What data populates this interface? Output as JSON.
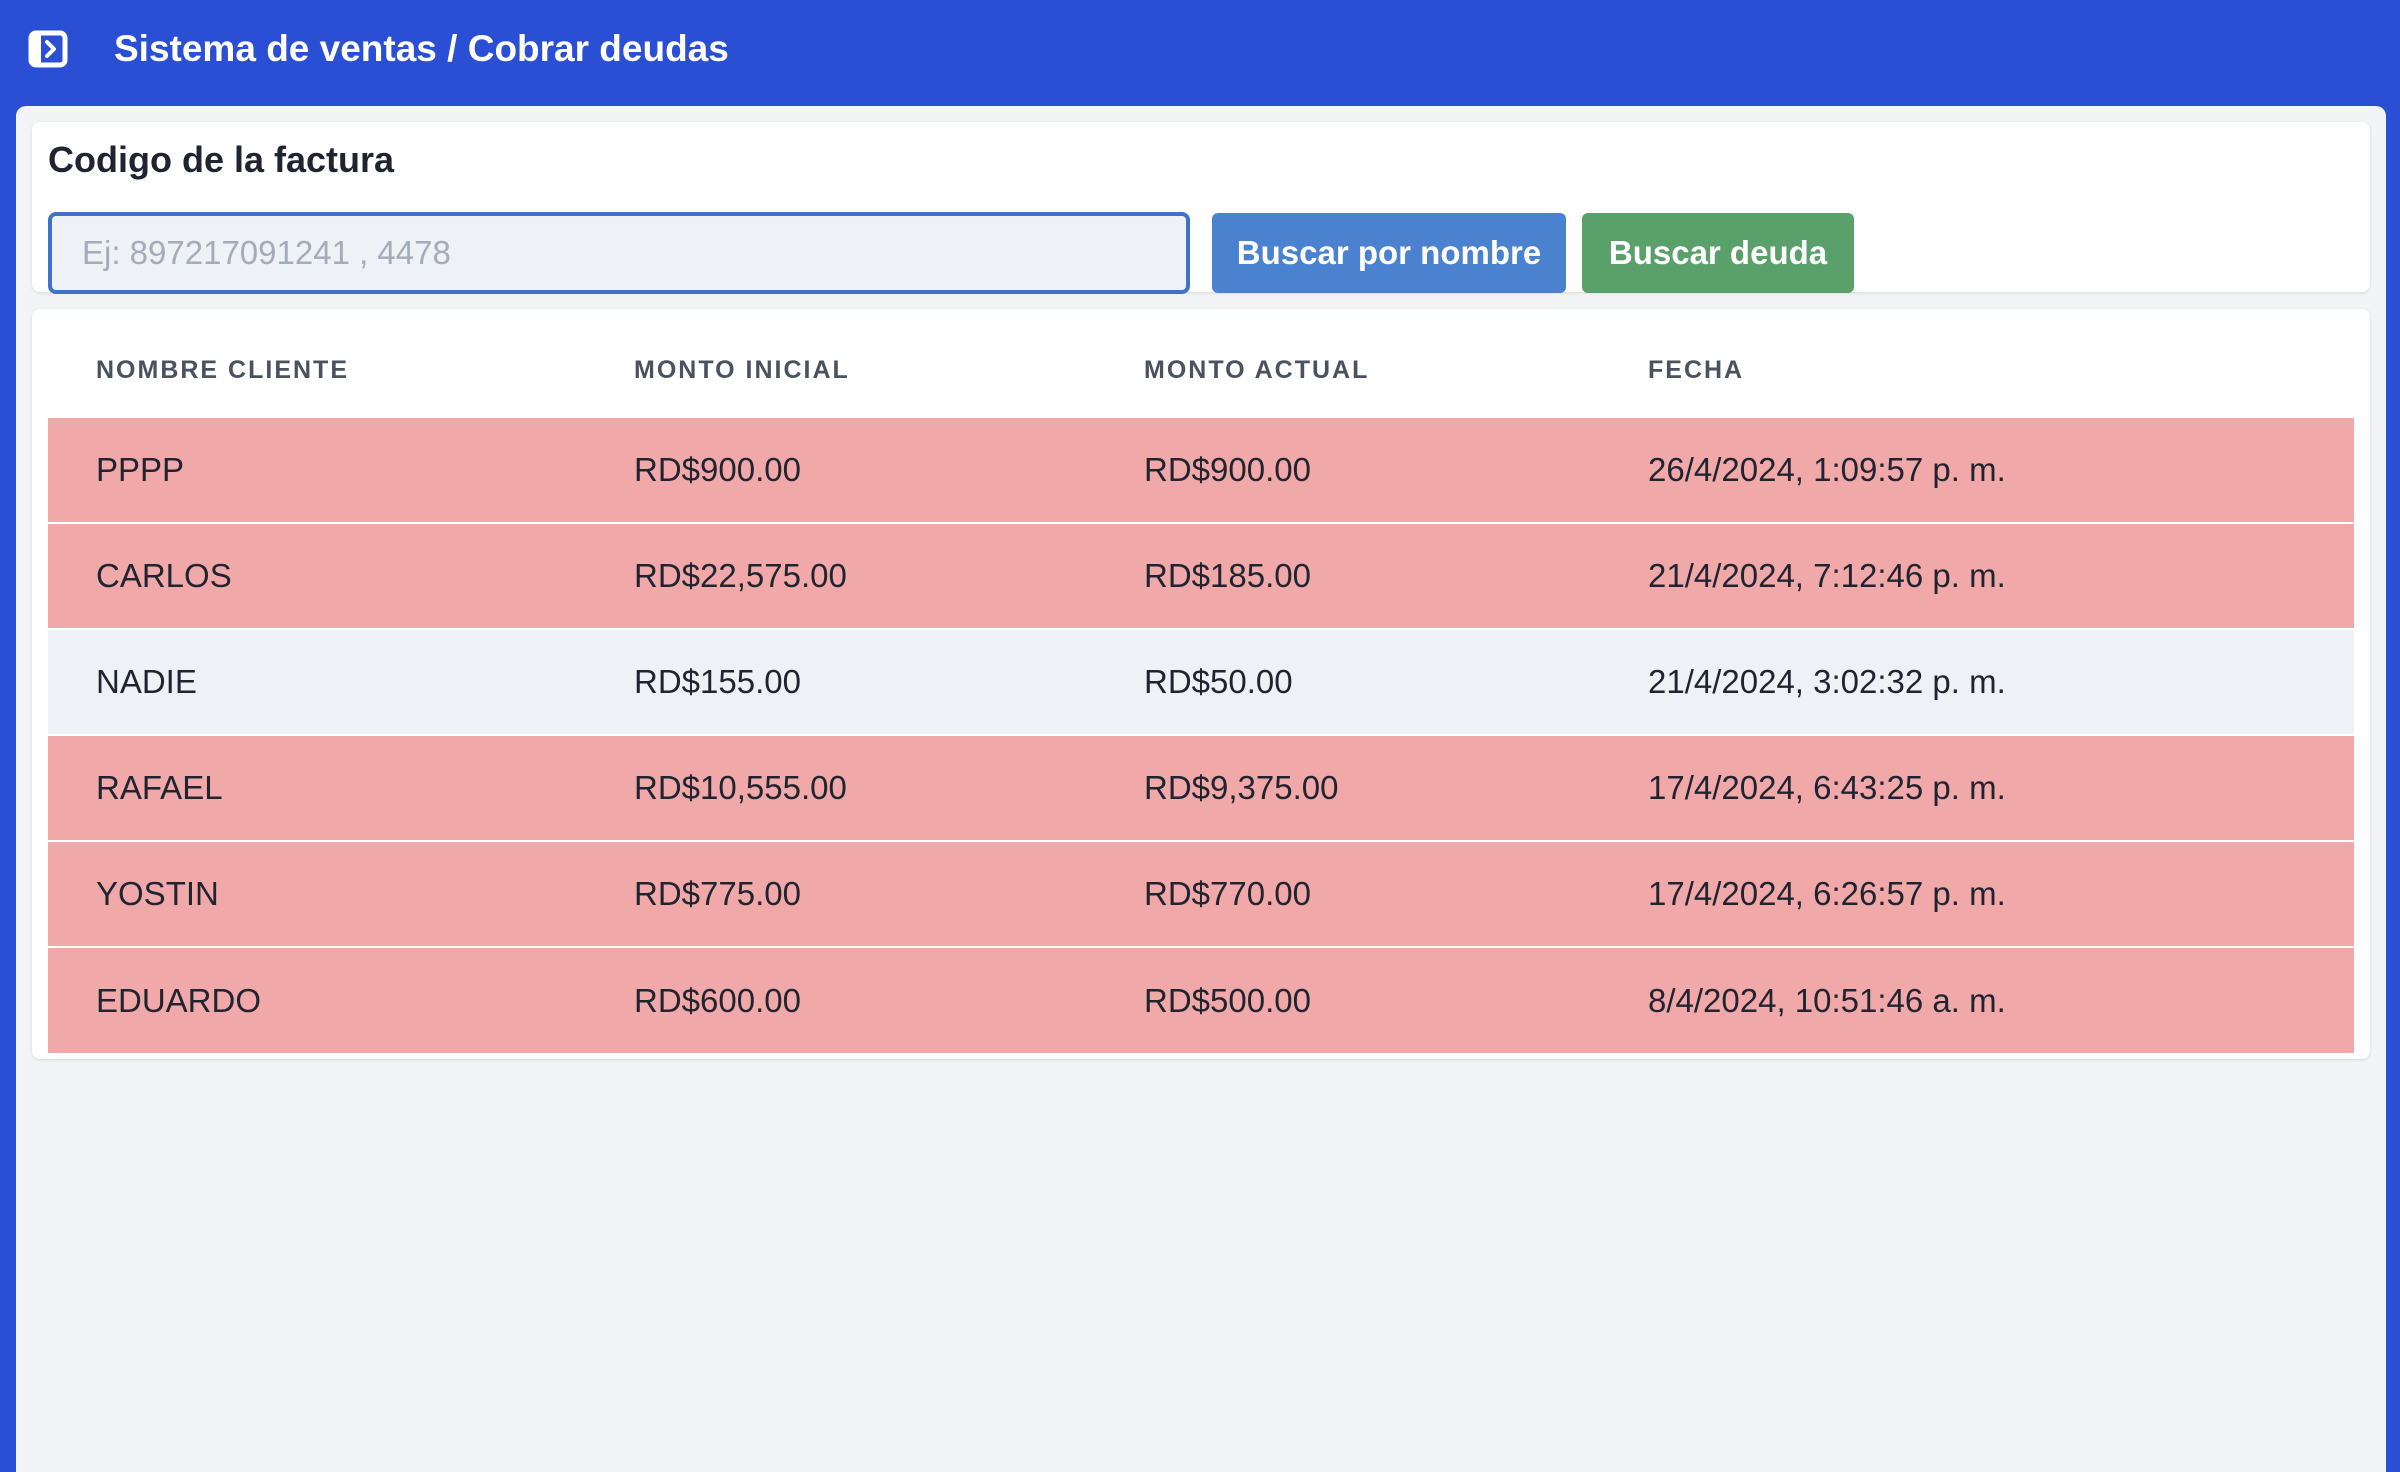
{
  "header": {
    "title": "Sistema de ventas / Cobrar deudas",
    "toggle_icon": "sidebar-toggle-icon"
  },
  "search": {
    "label": "Codigo de la factura",
    "value": "",
    "placeholder": "Ej: 897217091241 , 4478",
    "buttons": {
      "by_name": "Buscar por nombre",
      "debt": "Buscar deuda"
    }
  },
  "table": {
    "columns": [
      "NOMBRE CLIENTE",
      "MONTO INICIAL",
      "MONTO ACTUAL",
      "FECHA"
    ],
    "rows": [
      {
        "cliente": "PPPP",
        "monto_inicial": "RD$900.00",
        "monto_actual": "RD$900.00",
        "fecha": "26/4/2024, 1:09:57 p. m.",
        "status": "overdue"
      },
      {
        "cliente": "CARLOS",
        "monto_inicial": "RD$22,575.00",
        "monto_actual": "RD$185.00",
        "fecha": "21/4/2024, 7:12:46 p. m.",
        "status": "overdue"
      },
      {
        "cliente": "NADIE",
        "monto_inicial": "RD$155.00",
        "monto_actual": "RD$50.00",
        "fecha": "21/4/2024, 3:02:32 p. m.",
        "status": "normal"
      },
      {
        "cliente": "RAFAEL",
        "monto_inicial": "RD$10,555.00",
        "monto_actual": "RD$9,375.00",
        "fecha": "17/4/2024, 6:43:25 p. m.",
        "status": "overdue"
      },
      {
        "cliente": "YOSTIN",
        "monto_inicial": "RD$775.00",
        "monto_actual": "RD$770.00",
        "fecha": "17/4/2024, 6:26:57 p. m.",
        "status": "overdue"
      },
      {
        "cliente": "EDUARDO",
        "monto_inicial": "RD$600.00",
        "monto_actual": "RD$500.00",
        "fecha": "8/4/2024, 10:51:46 a. m.",
        "status": "overdue"
      }
    ]
  },
  "colors": {
    "header_bg": "#2b4fd4",
    "overdue_row": "#f0a8a8",
    "normal_row": "#eef1f5",
    "btn_name": "#4a82d0",
    "btn_debt": "#5aa06a",
    "input_border": "#3f72c8"
  }
}
